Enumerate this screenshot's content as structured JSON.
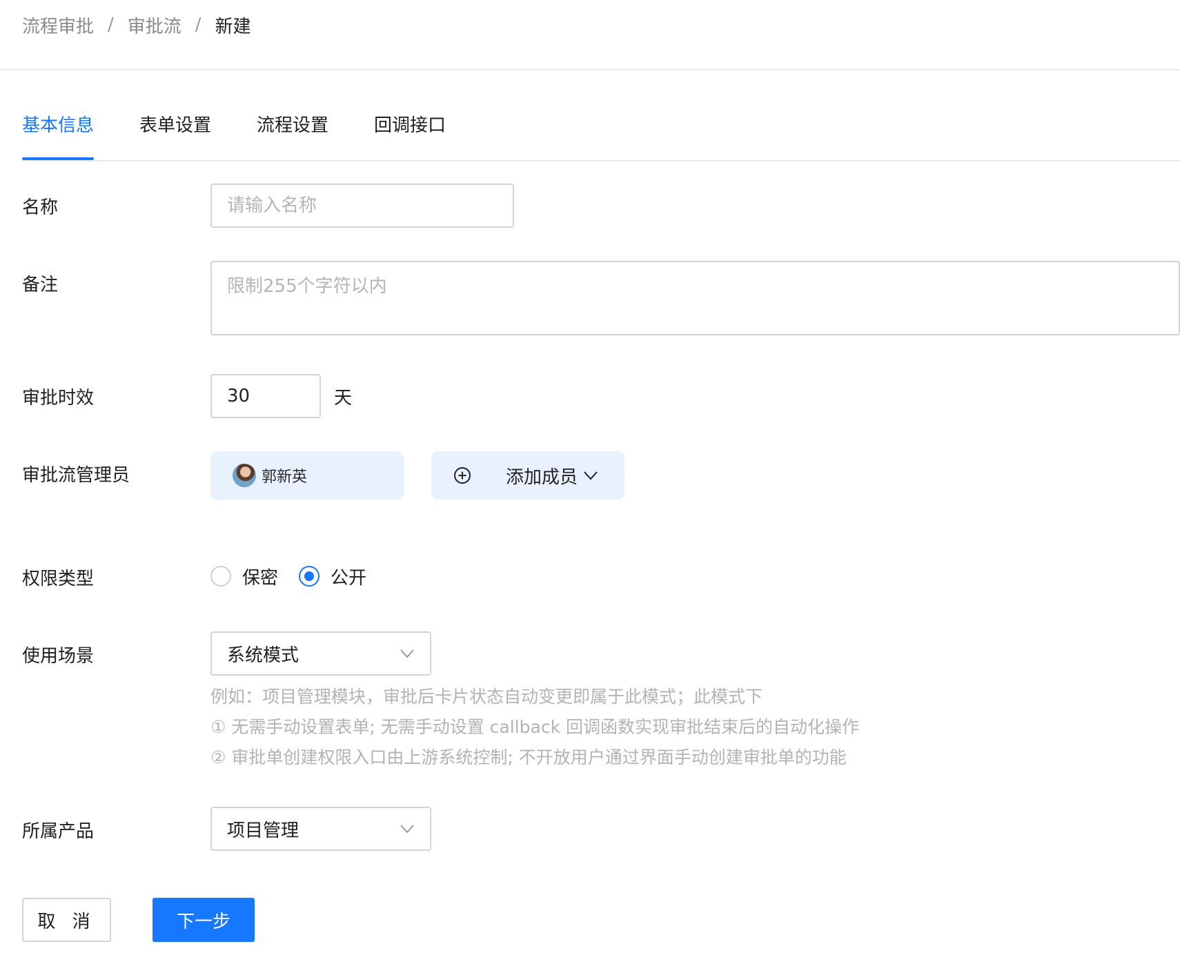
{
  "breadcrumb": {
    "items": [
      "流程审批",
      "审批流"
    ],
    "current": "新建",
    "separator": "/"
  },
  "tabs": [
    {
      "label": "基本信息",
      "active": true
    },
    {
      "label": "表单设置",
      "active": false
    },
    {
      "label": "流程设置",
      "active": false
    },
    {
      "label": "回调接口",
      "active": false
    }
  ],
  "form": {
    "name": {
      "label": "名称",
      "placeholder": "请输入名称",
      "value": ""
    },
    "remark": {
      "label": "备注",
      "placeholder": "限制255个字符以内",
      "value": ""
    },
    "duration": {
      "label": "审批时效",
      "value": "30",
      "unit": "天"
    },
    "admins": {
      "label": "审批流管理员",
      "members": [
        {
          "name": "郭新英",
          "icon": "avatar"
        }
      ],
      "add_label": "添加成员",
      "add_icon": "plus-circle-icon",
      "dropdown_icon": "chevron-down-icon"
    },
    "permission": {
      "label": "权限类型",
      "options": [
        {
          "label": "保密",
          "checked": false
        },
        {
          "label": "公开",
          "checked": true
        }
      ]
    },
    "scene": {
      "label": "使用场景",
      "value": "系统模式",
      "hint_lines": [
        "例如：项目管理模块，审批后卡片状态自动变更即属于此模式；此模式下",
        "① 无需手动设置表单; 无需手动设置 callback 回调函数实现审批结束后的自动化操作",
        "② 审批单创建权限入口由上游系统控制; 不开放用户通过界面手动创建审批单的功能"
      ]
    },
    "product": {
      "label": "所属产品",
      "value": "项目管理"
    }
  },
  "buttons": {
    "cancel": "取 消",
    "next": "下一步"
  },
  "colors": {
    "primary": "#1677ff",
    "chip_bg": "#e8f1fd"
  }
}
